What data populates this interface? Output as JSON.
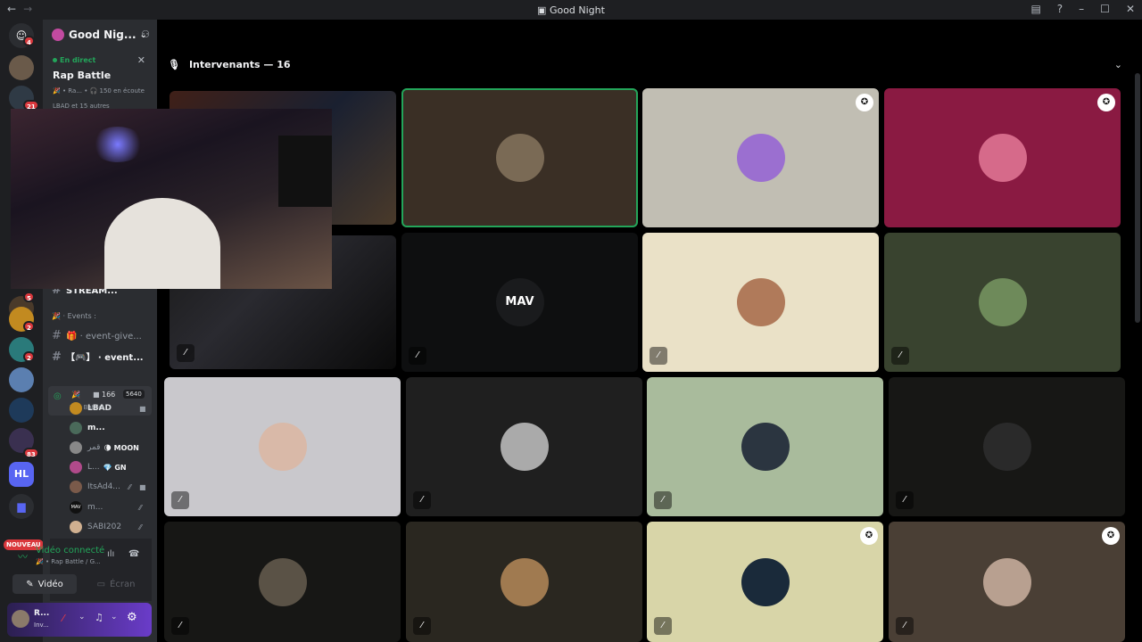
{
  "window": {
    "title": "Good Night"
  },
  "server_badges": {
    "top": "4",
    "b1": "21",
    "b2": "5",
    "b3": "2",
    "b4": "2",
    "b5": "83",
    "new": "NOUVEAU"
  },
  "guild": {
    "name": "Good Nig..."
  },
  "stage": {
    "live_label": "En direct",
    "name": "Rap Battle",
    "meta": "🎉 • Ra...  •  🎧 150 en écoute",
    "participants": "LBAD et 15 autres"
  },
  "channels": {
    "stream_row": "STREAM...",
    "events_header": "🎉 · Events :",
    "event_give": "🎁 · event-give...",
    "event_bracket": "【🎮】 · event...",
    "active_name": "🎉",
    "active_count": "166",
    "active_count2": "5640",
    "active_sub": "Rap Battle"
  },
  "users": [
    {
      "name": "LBAD"
    },
    {
      "name": "m..."
    },
    {
      "name": "قمر",
      "tag": "🌘 MOON"
    },
    {
      "name": "L...",
      "tag": "💎 GN"
    },
    {
      "name": "ItsAd4..."
    },
    {
      "name": "m..."
    },
    {
      "name": "SABI202"
    }
  ],
  "voice": {
    "status": "Vidéo connecté",
    "sub": "🎉 • Rap Battle / G...",
    "video_label": "Vidéo",
    "screen_label": "Écran"
  },
  "userbar": {
    "name": "R...",
    "sub": "Inv..."
  },
  "main": {
    "header": "Intervenants — 16"
  },
  "tiles": [
    {
      "bg": "#3a2f25",
      "av": "#7a6a55",
      "shield": false,
      "mute": false,
      "speaking": true
    },
    {
      "bg": "#c1beb3",
      "av": "#9b6fd0",
      "shield": true,
      "mute": false,
      "speaking": false
    },
    {
      "bg": "#8a1a42",
      "av": "#d66a8a",
      "shield": true,
      "mute": false,
      "speaking": false
    },
    {
      "bg": "#0e0f10",
      "av": "#1a1b1d",
      "shield": false,
      "mute": true,
      "speaking": false,
      "label": "MAV"
    },
    {
      "bg": "#eae1c7",
      "av": "#b07a5a",
      "shield": false,
      "mute": true,
      "speaking": false
    },
    {
      "bg": "#39432f",
      "av": "#6e8a5a",
      "shield": false,
      "mute": true,
      "speaking": false
    },
    {
      "bg": "#c9c8cc",
      "av": "#d9b9a8",
      "shield": false,
      "mute": true,
      "speaking": false
    },
    {
      "bg": "#1f1f1f",
      "av": "#aaaaaa",
      "shield": false,
      "mute": true,
      "speaking": false
    },
    {
      "bg": "#a9bb9c",
      "av": "#2b3540",
      "shield": false,
      "mute": true,
      "speaking": false
    },
    {
      "bg": "#171715",
      "av": "#2a2a2a",
      "shield": false,
      "mute": true,
      "speaking": false
    },
    {
      "bg": "#171715",
      "av": "#5a5246",
      "shield": false,
      "mute": true,
      "speaking": false
    },
    {
      "bg": "#2a2720",
      "av": "#a07a50",
      "shield": false,
      "mute": true,
      "speaking": false
    },
    {
      "bg": "#d8d5a8",
      "av": "#1a2a3a",
      "shield": true,
      "mute": true,
      "speaking": false
    },
    {
      "bg": "#4a3f35",
      "av": "#b8a090",
      "shield": true,
      "mute": true,
      "speaking": false
    }
  ]
}
